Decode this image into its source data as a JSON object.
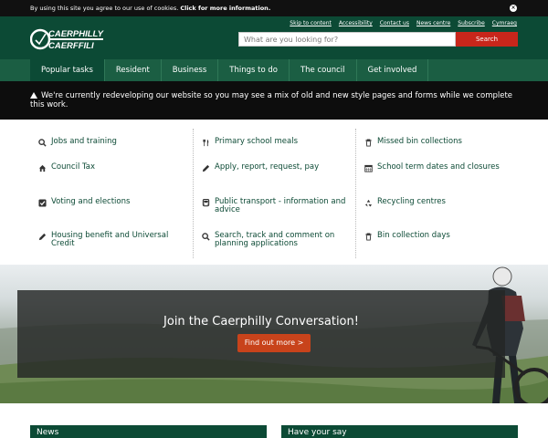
{
  "cookie_bar": {
    "text": "By using this site you agree to our use of cookies.",
    "link": "Click for more information."
  },
  "header": {
    "logo_text_en": "CAERPHILLY",
    "logo_text_cy": "CAERFFILI",
    "top_links": [
      "Skip to content",
      "Accessibility",
      "Contact us",
      "News centre",
      "Subscribe",
      "Cymraeg"
    ],
    "search": {
      "placeholder": "What are you looking for?",
      "button": "Search"
    }
  },
  "nav": {
    "items": [
      "Popular tasks",
      "Resident",
      "Business",
      "Things to do",
      "The council",
      "Get involved"
    ]
  },
  "alert": {
    "text": "We're currently redeveloping our website so you may see a mix of old and new style pages and forms while we complete this work."
  },
  "tasks": {
    "column1": [
      {
        "label": "Jobs and training",
        "icon": "search-icon"
      },
      {
        "label": "Council Tax",
        "icon": "home-icon"
      },
      {
        "label": "Voting and elections",
        "icon": "checkbox-icon"
      },
      {
        "label": "Housing benefit and Universal Credit",
        "icon": "pencil-icon"
      }
    ],
    "column2": [
      {
        "label": "Primary school meals",
        "icon": "cutlery-icon"
      },
      {
        "label": "Apply, report, request, pay",
        "icon": "pencil-icon"
      },
      {
        "label": "Public transport - information and advice",
        "icon": "bus-icon"
      },
      {
        "label": "Search, track and comment on planning applications",
        "icon": "search-icon"
      }
    ],
    "column3": [
      {
        "label": "Missed bin collections",
        "icon": "bin-icon"
      },
      {
        "label": "School term dates and closures",
        "icon": "calendar-icon"
      },
      {
        "label": "Recycling centres",
        "icon": "recycle-icon"
      },
      {
        "label": "Bin collection days",
        "icon": "bin-icon"
      }
    ]
  },
  "hero": {
    "title": "Join the Caerphilly Conversation!",
    "button": "Find out more >"
  },
  "panels": {
    "news": "News",
    "have_your_say": "Have your say"
  },
  "colors": {
    "brand_green": "#0c4a35",
    "nav_green": "#1b5e43",
    "accent_red": "#c8261b",
    "button_orange": "#c8431b"
  }
}
